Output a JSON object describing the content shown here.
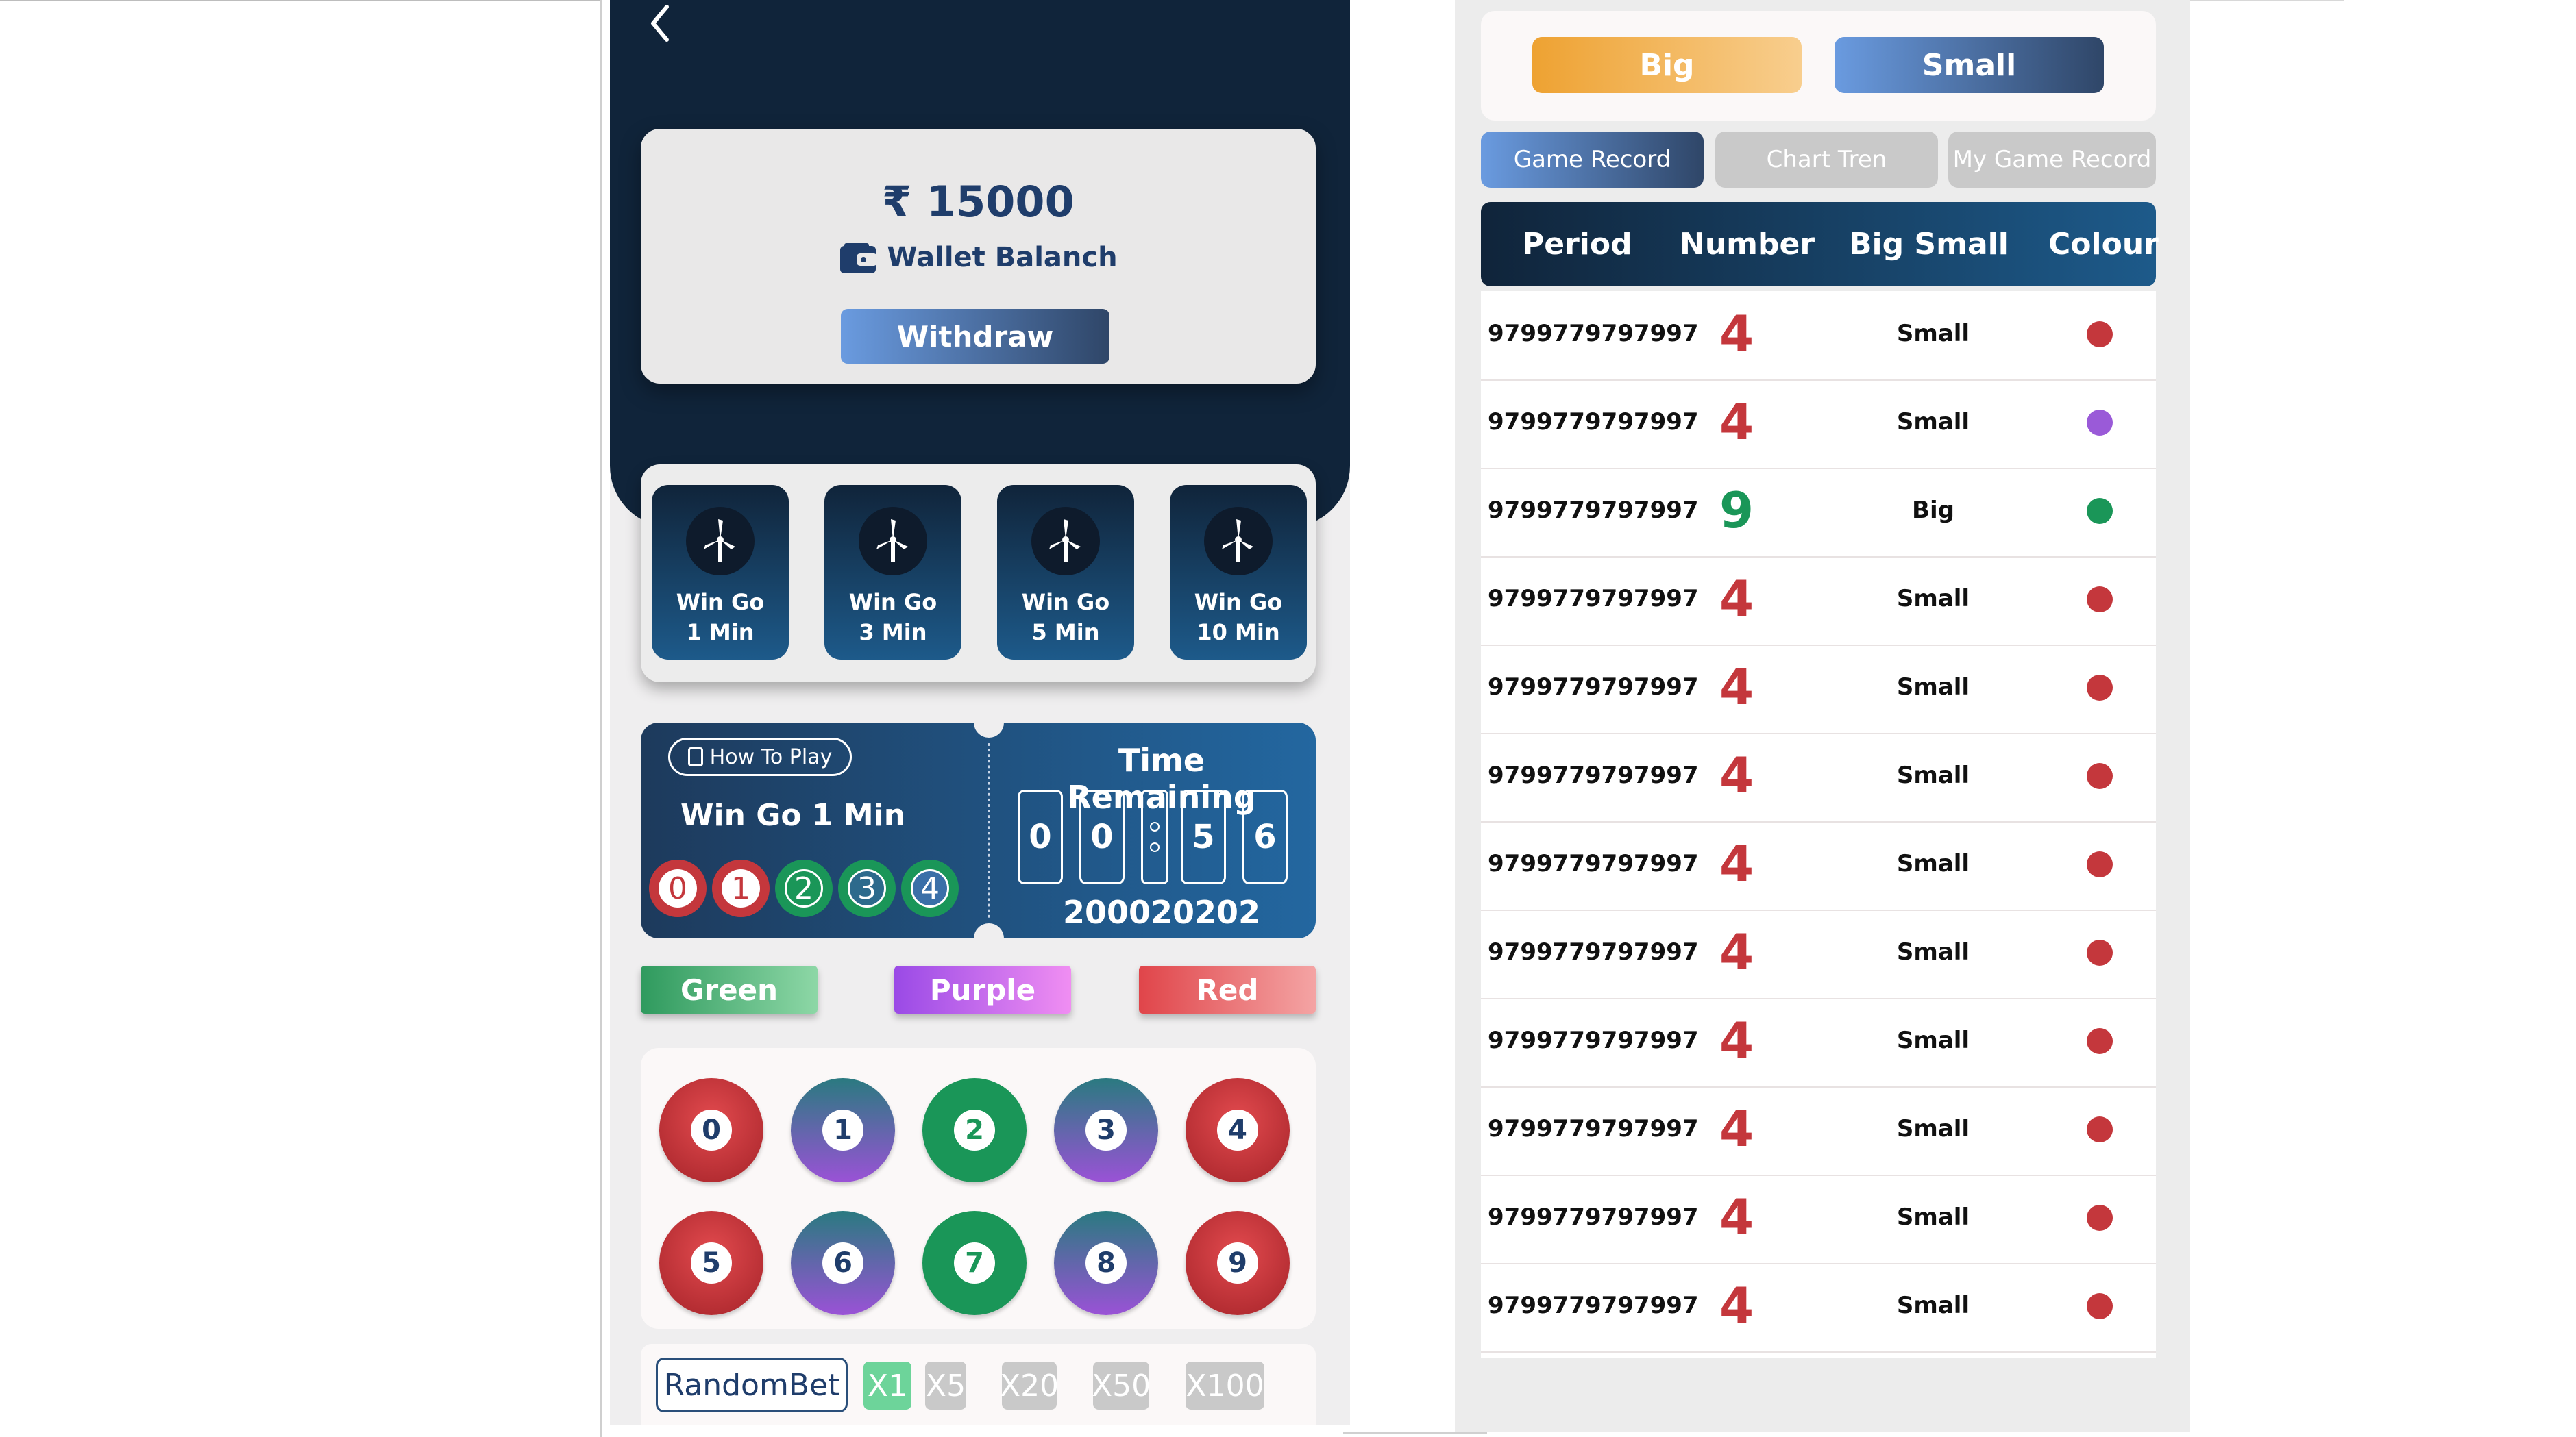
{
  "colors": {
    "navy": "#10243a",
    "red": "#c4373c",
    "green": "#1a9658",
    "purple": "#9a5ad8",
    "accent_blue": "#1f3d6b"
  },
  "left": {
    "wallet": {
      "currency": "₹",
      "amount": "15000",
      "label": "Wallet Balanch",
      "withdraw": "Withdraw"
    },
    "games": [
      {
        "line1": "Win Go",
        "line2": "1 Min"
      },
      {
        "line1": "Win Go",
        "line2": "3 Min"
      },
      {
        "line1": "Win Go",
        "line2": "5 Min"
      },
      {
        "line1": "Win Go",
        "line2": "10 Min"
      }
    ],
    "timer": {
      "how_to": "How To Play",
      "game_title": "Win Go 1 Min",
      "recent_numbers": [
        "0",
        "1",
        "2",
        "3",
        "4"
      ],
      "time_remaining_label": "Time Remaining",
      "digits": [
        "0",
        "0",
        "5",
        "6"
      ],
      "period": "200020202"
    },
    "color_buttons": {
      "green": "Green",
      "purple": "Purple",
      "red": "Red"
    },
    "numbers": [
      "0",
      "1",
      "2",
      "3",
      "4",
      "5",
      "6",
      "7",
      "8",
      "9"
    ],
    "bet": {
      "random": "RandomBet",
      "multipliers": [
        "X1",
        "X5",
        "X20",
        "X50",
        "X100"
      ]
    }
  },
  "right": {
    "big": "Big",
    "small": "Small",
    "tabs": [
      "Game Record",
      "Chart Tren",
      "My Game Record"
    ],
    "columns": [
      "Period",
      "Number",
      "Big Small",
      "Colour"
    ],
    "rows": [
      {
        "period": "9799779797997",
        "number": "4",
        "bs": "Small",
        "colour": "red"
      },
      {
        "period": "9799779797997",
        "number": "4",
        "bs": "Small",
        "colour": "purple"
      },
      {
        "period": "9799779797997",
        "number": "9",
        "bs": "Big",
        "colour": "green"
      },
      {
        "period": "9799779797997",
        "number": "4",
        "bs": "Small",
        "colour": "red"
      },
      {
        "period": "9799779797997",
        "number": "4",
        "bs": "Small",
        "colour": "red"
      },
      {
        "period": "9799779797997",
        "number": "4",
        "bs": "Small",
        "colour": "red"
      },
      {
        "period": "9799779797997",
        "number": "4",
        "bs": "Small",
        "colour": "red"
      },
      {
        "period": "9799779797997",
        "number": "4",
        "bs": "Small",
        "colour": "red"
      },
      {
        "period": "9799779797997",
        "number": "4",
        "bs": "Small",
        "colour": "red"
      },
      {
        "period": "9799779797997",
        "number": "4",
        "bs": "Small",
        "colour": "red"
      },
      {
        "period": "9799779797997",
        "number": "4",
        "bs": "Small",
        "colour": "red"
      },
      {
        "period": "9799779797997",
        "number": "4",
        "bs": "Small",
        "colour": "red"
      }
    ]
  }
}
